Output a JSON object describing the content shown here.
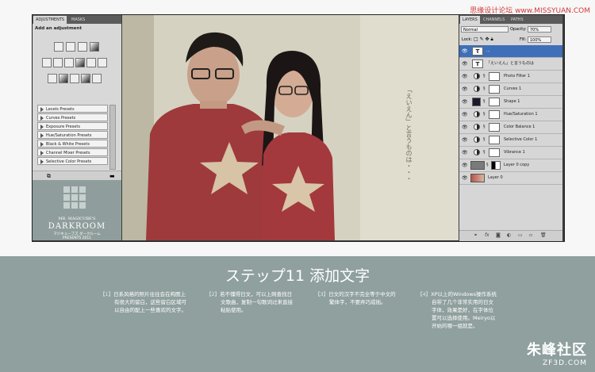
{
  "site_watermark": "思缘设计论坛 www.MISSYUAN.COM",
  "adjustments_panel": {
    "tabs": [
      "ADJUSTMENTS",
      "MASKS"
    ],
    "heading": "Add an adjustment",
    "presets": [
      "Levels Presets",
      "Curves Presets",
      "Exposure Presets",
      "Hue/Saturation Presets",
      "Black & White Presets",
      "Channel Mixer Presets",
      "Selective Color Presets"
    ]
  },
  "darkroom": {
    "line1": "MR. MAGICUBE'S",
    "line2": "DARKROOM",
    "line3": "マジキューブズ ダークルーム",
    "line4": "PRESENTS 2011"
  },
  "photo": {
    "vertical_text": "「えいえん」と言うものは・・・"
  },
  "layers_panel": {
    "tabs": [
      "LAYERS",
      "CHANNELS",
      "PATHS"
    ],
    "blend_mode": "Normal",
    "opacity_label": "Opacity:",
    "opacity_value": "70%",
    "lock_label": "Lock:",
    "fill_label": "Fill:",
    "fill_value": "100%",
    "layers": [
      {
        "name": "...",
        "kind": "text",
        "active": true
      },
      {
        "name": "「えいえん」と言うものは",
        "kind": "text",
        "active": false
      },
      {
        "name": "Photo Filter 1",
        "kind": "adjustment",
        "active": false
      },
      {
        "name": "Curves 1",
        "kind": "adjustment",
        "active": false
      },
      {
        "name": "Shape 1",
        "kind": "shape",
        "active": false
      },
      {
        "name": "Hue/Saturation 1",
        "kind": "adjustment",
        "active": false
      },
      {
        "name": "Color Balance 1",
        "kind": "adjustment",
        "active": false
      },
      {
        "name": "Selective Color 1",
        "kind": "adjustment",
        "active": false
      },
      {
        "name": "Vibrance 1",
        "kind": "adjustment",
        "active": false
      },
      {
        "name": "Layer 0 copy",
        "kind": "image",
        "active": false
      },
      {
        "name": "Layer 0",
        "kind": "image",
        "active": false
      }
    ]
  },
  "tutorial": {
    "title": "ステップ11 添加文字",
    "columns": [
      {
        "num": "【1】",
        "lines": [
          "日系风格的照片往往会在构图上",
          "有很大的留白，这些留白区域可",
          "以自由的配上一些喜欢的文字。"
        ]
      },
      {
        "num": "【2】",
        "lines": [
          "若不懂得日文，可以上网查找日",
          "文歌曲，复制一句歌词过来直接",
          "粘贴使用。"
        ]
      },
      {
        "num": "【3】",
        "lines": [
          "日文的汉字不完全等于中文的",
          "繁体字，不要弄巧成拙。"
        ]
      },
      {
        "num": "【4】",
        "lines": [
          "XP以上的Windows操作系统",
          "自带了几个非常实用的日文",
          "字体，效果是好，在字体位",
          "置可以选择使用。Meiryo以",
          "开始的哪一组就是。"
        ]
      }
    ]
  },
  "brand": {
    "name": "朱峰社区",
    "url": "ZF3D.COM"
  }
}
